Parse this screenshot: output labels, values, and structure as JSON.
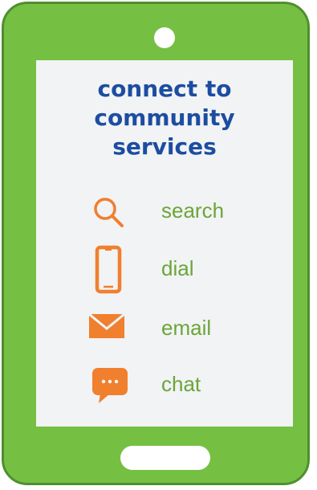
{
  "headline": {
    "line1": "connect to",
    "line2": "community",
    "line3": "services"
  },
  "services": [
    {
      "label": "search",
      "icon": "search-icon"
    },
    {
      "label": "dial",
      "icon": "phone-icon"
    },
    {
      "label": "email",
      "icon": "envelope-icon"
    },
    {
      "label": "chat",
      "icon": "chat-bubble-icon"
    }
  ],
  "colors": {
    "phone_body": "#75c043",
    "phone_border": "#4f8f2e",
    "screen": "#f2f3f4",
    "headline": "#1c4da1",
    "icon": "#f07f2e",
    "label": "#6aa63a"
  }
}
